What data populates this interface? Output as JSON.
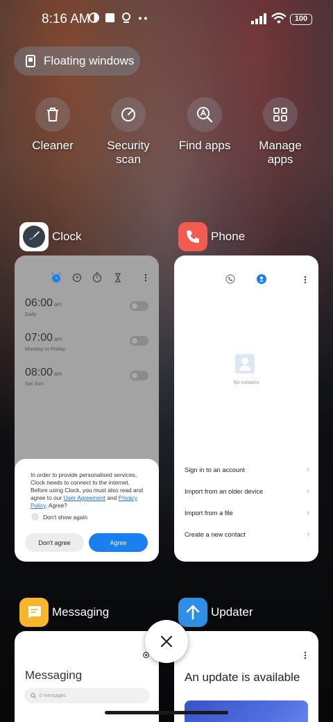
{
  "status_bar": {
    "time": "8:16 AM",
    "battery": "100"
  },
  "floating_windows": {
    "label": "Floating windows"
  },
  "quick_actions": [
    {
      "label": "Cleaner",
      "icon": "trash-icon"
    },
    {
      "label": "Security scan",
      "icon": "security-scan-icon"
    },
    {
      "label": "Find apps",
      "icon": "find-apps-icon"
    },
    {
      "label": "Manage apps",
      "icon": "manage-apps-icon"
    }
  ],
  "clock_app": {
    "name": "Clock",
    "alarms": [
      {
        "time": "06:00",
        "ampm": "am",
        "repeat": "Daily"
      },
      {
        "time": "07:00",
        "ampm": "am",
        "repeat": "Monday to Friday"
      },
      {
        "time": "08:00",
        "ampm": "am",
        "repeat": "Sat Sun"
      }
    ],
    "dialog": {
      "message_pre": "In order to provide personalised services, Clock needs to connect to the internet. Before using Clock, you must also read and agree to our ",
      "user_agreement": "User Agreement",
      "and": " and ",
      "privacy_policy": "Privacy Policy",
      "message_post": ". Agree?",
      "checkbox_label": "Don't show again",
      "disagree_label": "Don't agree",
      "agree_label": "Agree"
    }
  },
  "phone_app": {
    "name": "Phone",
    "no_contacts": "No contacts",
    "options": [
      "Sign in to an account",
      "Import from an older device",
      "Import from a file",
      "Create a new contact"
    ]
  },
  "messaging_app": {
    "name": "Messaging",
    "title": "Messaging",
    "search_placeholder": "0 messages"
  },
  "updater_app": {
    "name": "Updater",
    "title": "An update is available"
  },
  "colors": {
    "accent_blue": "#1a7ff0",
    "phone_red": "#f25b50",
    "messaging_yellow": "#f7b52c",
    "updater_blue": "#2f8fe6"
  }
}
